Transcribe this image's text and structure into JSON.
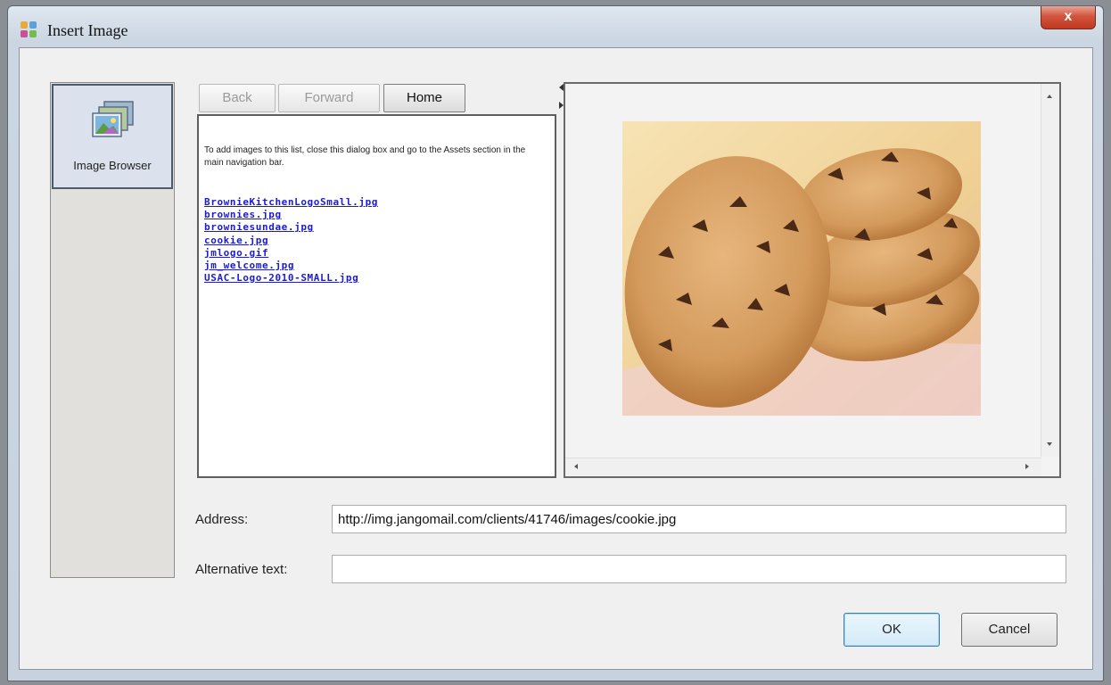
{
  "window": {
    "title": "Insert Image",
    "close_label": "x"
  },
  "sidebar": {
    "items": [
      {
        "label": "Image Browser",
        "icon": "image-stack-icon"
      }
    ]
  },
  "browser": {
    "nav": {
      "back": "Back",
      "forward": "Forward",
      "home": "Home"
    },
    "help_text": "To add images to this list, close this dialog box and go to the Assets section in the main navigation bar.",
    "files": [
      "BrownieKitchenLogoSmall.jpg",
      "brownies.jpg",
      "browniesundae.jpg",
      "cookie.jpg",
      "jmlogo.gif",
      "jm_welcome.jpg",
      "USAC-Logo-2010-SMALL.jpg"
    ]
  },
  "preview": {
    "image_subject": "cookie-photo"
  },
  "form": {
    "address_label": "Address:",
    "address_value": "http://img.jangomail.com/clients/41746/images/cookie.jpg",
    "alt_label": "Alternative text:",
    "alt_value": ""
  },
  "buttons": {
    "ok": "OK",
    "cancel": "Cancel"
  },
  "colors": {
    "link": "#1a1ad8",
    "close": "#c7432a",
    "ok_border": "#3c7fb1"
  }
}
